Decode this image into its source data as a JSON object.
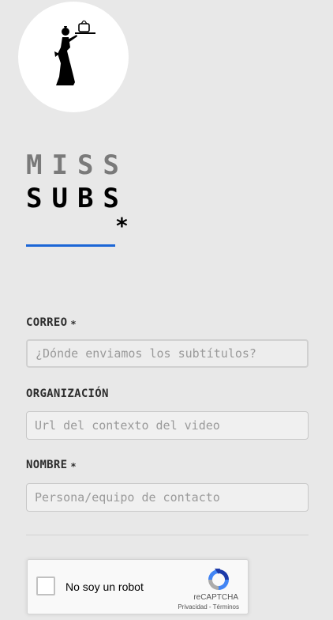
{
  "logo": {
    "icon": "waitress-with-tray-icon"
  },
  "brand": {
    "line1": "MISS",
    "line2": "SUBS",
    "star": "*"
  },
  "form": {
    "email": {
      "label": "CORREO",
      "required_mark": "*",
      "placeholder": "¿Dónde enviamos los subtítulos?",
      "value": ""
    },
    "organization": {
      "label": "ORGANIZACIÓN",
      "placeholder": "Url del contexto del video",
      "value": ""
    },
    "name": {
      "label": "NOMBRE",
      "required_mark": "*",
      "placeholder": "Persona/equipo de contacto",
      "value": ""
    }
  },
  "captcha": {
    "label": "No soy un robot",
    "brand": "reCAPTCHA",
    "privacy": "Privacidad",
    "separator": " - ",
    "terms": "Términos"
  },
  "colors": {
    "background": "#e8e8e8",
    "accent": "#1b66d6",
    "brand_gray": "#7a7a7a",
    "brand_black": "#000000"
  }
}
